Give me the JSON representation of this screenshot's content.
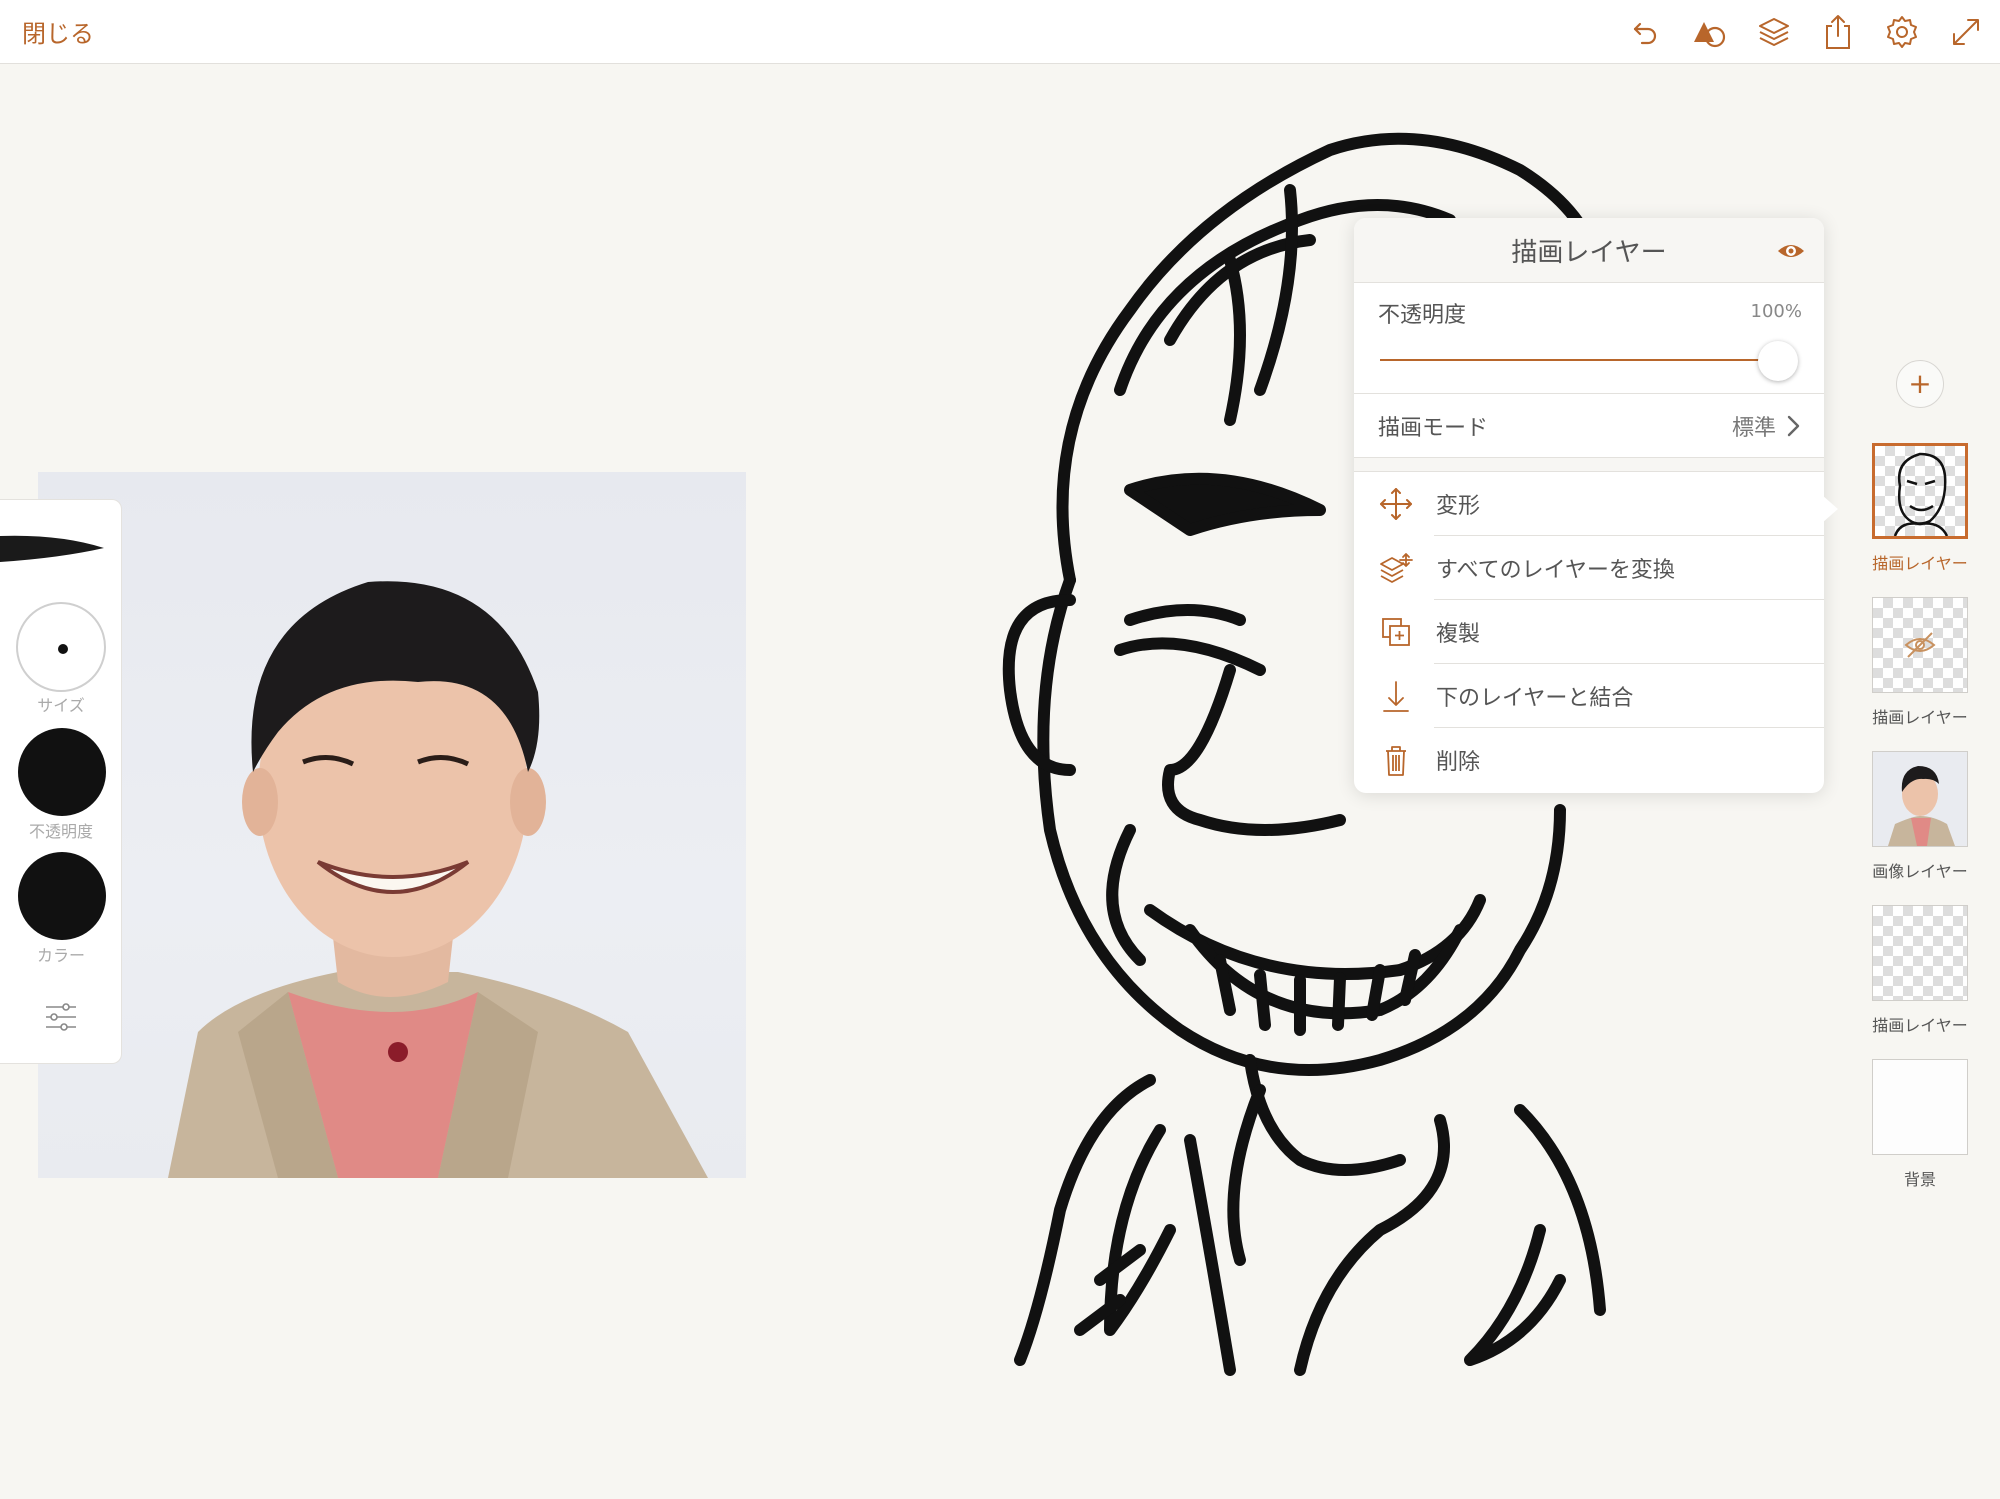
{
  "toolbar": {
    "close_label": "閉じる",
    "icons": [
      "undo-icon",
      "shapes-icon",
      "layers-icon",
      "share-icon",
      "gear-icon",
      "expand-icon"
    ]
  },
  "tools": {
    "size_label": "サイズ",
    "opacity_label": "不透明度",
    "color_label": "カラー"
  },
  "layer_popover": {
    "title": "描画レイヤー",
    "opacity_label": "不透明度",
    "opacity_value": "100%",
    "opacity_level": 1.0,
    "blend_mode_label": "描画モード",
    "blend_mode_value": "標準",
    "actions": [
      {
        "label": "変形",
        "icon": "move-icon"
      },
      {
        "label": "すべてのレイヤーを変換",
        "icon": "transform-all-layers-icon"
      },
      {
        "label": "複製",
        "icon": "duplicate-icon"
      },
      {
        "label": "下のレイヤーと結合",
        "icon": "merge-down-icon"
      },
      {
        "label": "削除",
        "icon": "trash-icon"
      }
    ]
  },
  "layers": [
    {
      "label": "描画レイヤー",
      "selected": true
    },
    {
      "label": "描画レイヤー",
      "hidden": true
    },
    {
      "label": "画像レイヤー"
    },
    {
      "label": "描画レイヤー"
    },
    {
      "label": "背景"
    }
  ],
  "colors": {
    "accent": "#b8662b",
    "canvas": "#f7f6f2",
    "ink": "#111111"
  }
}
